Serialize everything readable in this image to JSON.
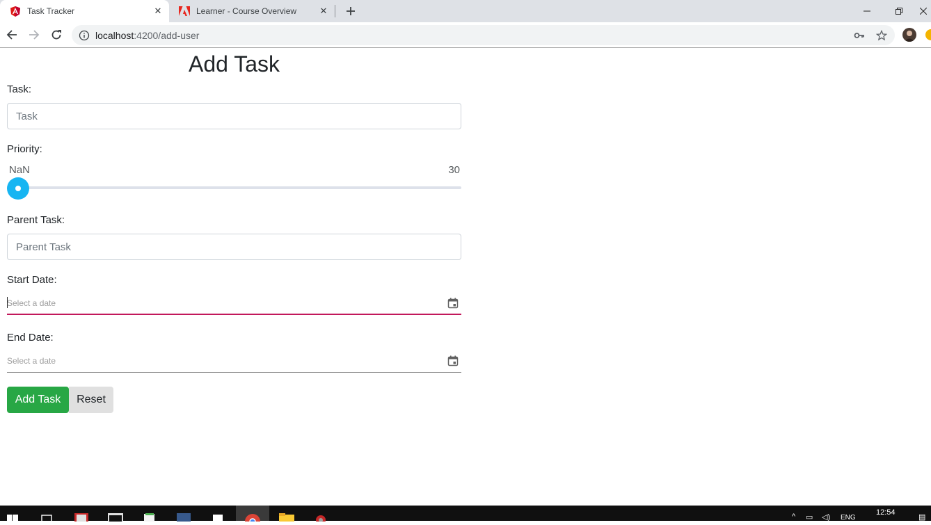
{
  "browser": {
    "tabs": [
      {
        "title": "Task Tracker",
        "active": true,
        "icon": "angular-icon"
      },
      {
        "title": "Learner - Course Overview",
        "active": false,
        "icon": "adobe-icon"
      }
    ],
    "address": {
      "host": "localhost",
      "path": ":4200/add-user"
    }
  },
  "form": {
    "heading": "Add Task",
    "task": {
      "label": "Task:",
      "placeholder": "Task"
    },
    "priority": {
      "label": "Priority:",
      "min_label": "NaN",
      "max_label": "30",
      "value_fraction": 0
    },
    "parent_task": {
      "label": "Parent Task:",
      "placeholder": "Parent Task"
    },
    "start_date": {
      "label": "Start Date:",
      "placeholder": "Select a date"
    },
    "end_date": {
      "label": "End Date:",
      "placeholder": "Select a date"
    },
    "buttons": {
      "add": "Add Task",
      "reset": "Reset"
    }
  },
  "taskbar": {
    "clock": "12:54",
    "language": "ENG"
  },
  "colors": {
    "accent_slider": "#17b5f2",
    "add_button": "#28a745",
    "focus_underline": "#c2185b"
  }
}
